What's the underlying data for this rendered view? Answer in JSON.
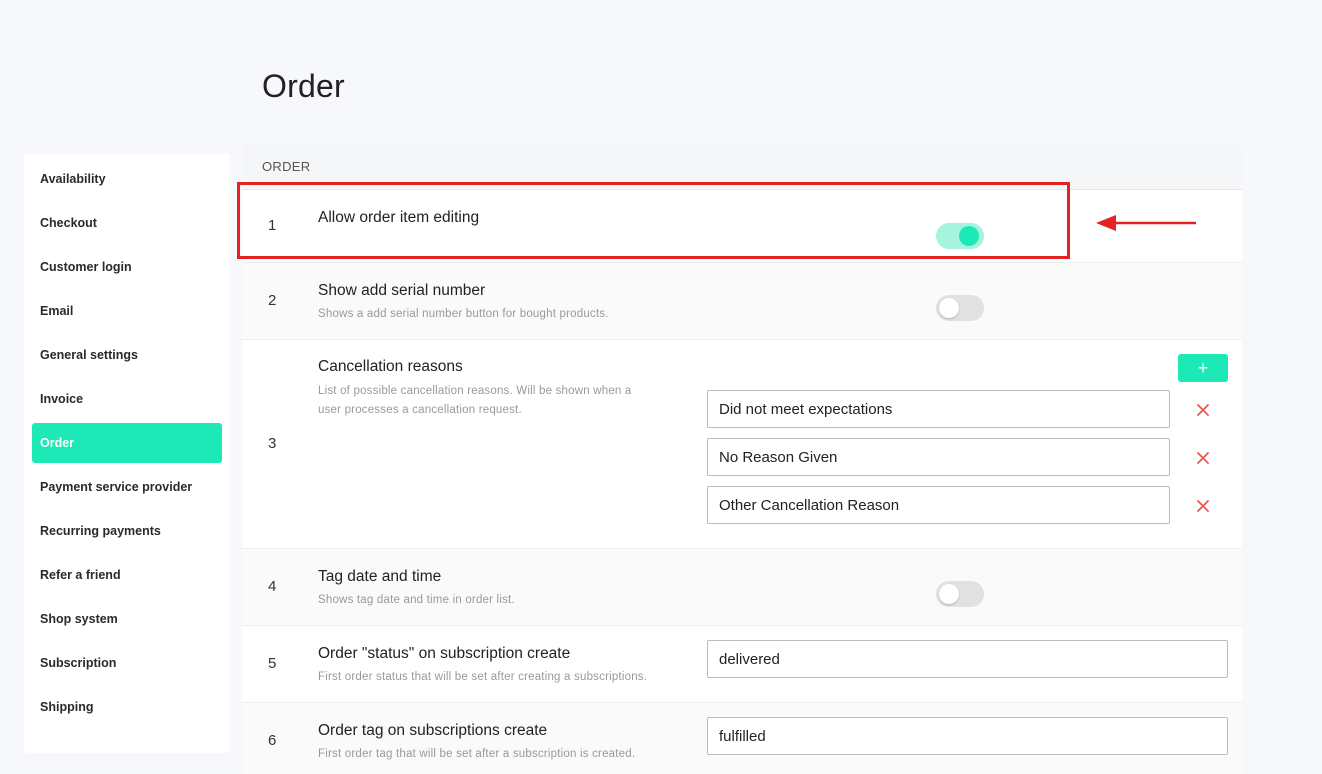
{
  "page": {
    "title": "Order"
  },
  "sidebar": {
    "items": [
      {
        "label": "Availability"
      },
      {
        "label": "Checkout"
      },
      {
        "label": "Customer login"
      },
      {
        "label": "Email"
      },
      {
        "label": "General settings"
      },
      {
        "label": "Invoice"
      },
      {
        "label": "Order",
        "active": true
      },
      {
        "label": "Payment service provider"
      },
      {
        "label": "Recurring payments"
      },
      {
        "label": "Refer a friend"
      },
      {
        "label": "Shop system"
      },
      {
        "label": "Subscription"
      },
      {
        "label": "Shipping"
      }
    ]
  },
  "panel": {
    "header": "ORDER",
    "rows": [
      {
        "num": "1",
        "title": "Allow order item editing",
        "desc": "",
        "toggle": true
      },
      {
        "num": "2",
        "title": "Show add serial number",
        "desc": "Shows a add serial number button for bought products.",
        "toggle": false
      },
      {
        "num": "3",
        "title": "Cancellation reasons",
        "desc_line1": "List of possible cancellation reasons. Will be shown when a",
        "desc_line2": "user processes a cancellation request.",
        "add_label": "+",
        "reasons": [
          "Did not meet expectations",
          "No Reason Given",
          "Other Cancellation Reason"
        ]
      },
      {
        "num": "4",
        "title": "Tag date and time",
        "desc": "Shows tag date and time in order list.",
        "toggle": false
      },
      {
        "num": "5",
        "title": "Order \"status\" on subscription create",
        "desc": "First order status that will be set after creating a subscriptions.",
        "value": "delivered"
      },
      {
        "num": "6",
        "title": "Order tag on subscriptions create",
        "desc": "First order tag that will be set after a subscription is created.",
        "value": "fulfilled"
      }
    ]
  },
  "colors": {
    "accent": "#1de9b6",
    "highlight": "#e32222",
    "remove": "#f05454"
  },
  "icons": {
    "remove": "close-icon",
    "add": "plus-icon",
    "annotation": "arrow-left-icon"
  }
}
